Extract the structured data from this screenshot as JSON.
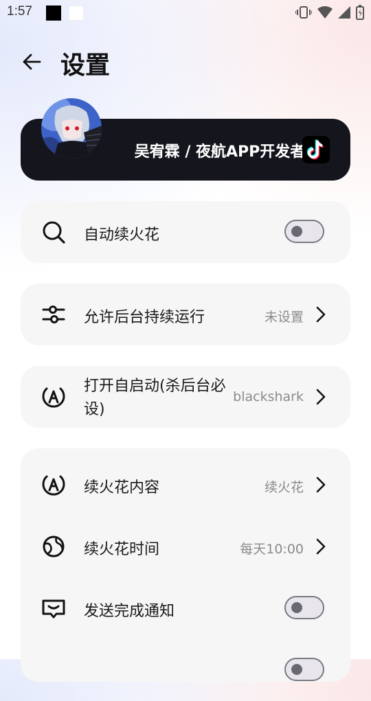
{
  "status_bar": {
    "time": "1:57"
  },
  "header": {
    "title": "设置"
  },
  "profile": {
    "name": "吴宥霖 / 夜航APP开发者"
  },
  "settings": {
    "auto_streak": {
      "label": "自动续火花",
      "enabled": false
    },
    "background_run": {
      "label": "允许后台持续运行",
      "value": "未设置"
    },
    "autostart": {
      "label": "打开自启动(杀后台必设)",
      "value": "blackshark"
    },
    "content": {
      "label": "续火花内容",
      "value": "续火花"
    },
    "time": {
      "label": "续火花时间",
      "value": "每天10:00"
    },
    "notify": {
      "label": "发送完成通知",
      "enabled": false
    }
  },
  "colors": {
    "card_bg": "#f6f6f7",
    "profile_bg": "#15161d",
    "toggle_border": "#7a7880"
  }
}
